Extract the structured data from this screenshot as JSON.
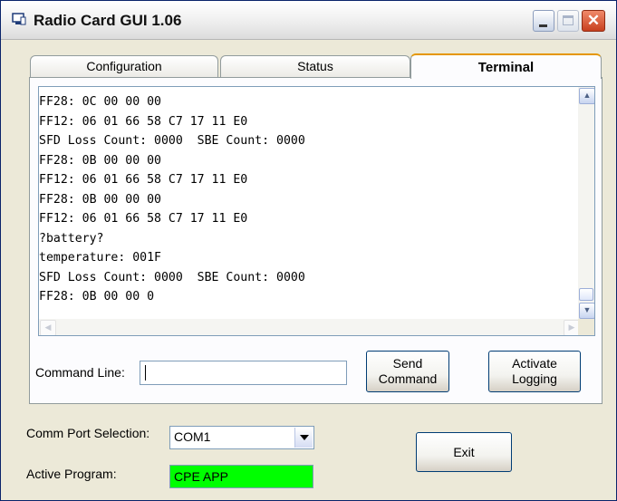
{
  "window": {
    "title": "Radio Card GUI 1.06"
  },
  "tabs": [
    {
      "label": "Configuration"
    },
    {
      "label": "Status"
    },
    {
      "label": "Terminal"
    }
  ],
  "terminal": {
    "lines": [
      "FF28: 0C 00 00 00",
      "FF12: 06 01 66 58 C7 17 11 E0",
      "SFD Loss Count: 0000  SBE Count: 0000",
      "FF28: 0B 00 00 00",
      "FF12: 06 01 66 58 C7 17 11 E0",
      "FF28: 0B 00 00 00",
      "FF12: 06 01 66 58 C7 17 11 E0",
      "?battery?",
      "temperature: 001F",
      "SFD Loss Count: 0000  SBE Count: 0000",
      "FF28: 0B 00 00 0"
    ]
  },
  "command": {
    "label": "Command Line:",
    "value": "",
    "send_label_1": "Send",
    "send_label_2": "Command",
    "log_label_1": "Activate",
    "log_label_2": "Logging"
  },
  "comm": {
    "label": "Comm Port Selection:",
    "selected": "COM1"
  },
  "program": {
    "label": "Active Program:",
    "value": "CPE APP",
    "status_color": "#00ff00"
  },
  "exit_label": "Exit",
  "icons": [
    "app-icon",
    "minimize-icon",
    "maximize-icon",
    "close-icon",
    "scroll-up-icon",
    "scroll-down-icon",
    "scroll-left-icon",
    "scroll-right-icon",
    "dropdown-arrow-icon"
  ]
}
